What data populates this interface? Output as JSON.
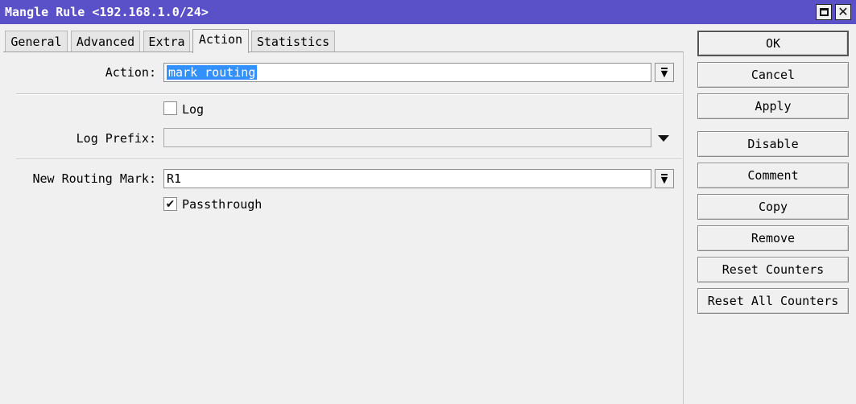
{
  "window": {
    "title": "Mangle Rule <192.168.1.0/24>"
  },
  "tabs": [
    {
      "label": "General"
    },
    {
      "label": "Advanced"
    },
    {
      "label": "Extra"
    },
    {
      "label": "Action"
    },
    {
      "label": "Statistics"
    }
  ],
  "active_tab": "Action",
  "form": {
    "action": {
      "label": "Action:",
      "value": "mark routing"
    },
    "log": {
      "label": "Log",
      "checked": false
    },
    "log_prefix": {
      "label": "Log Prefix:",
      "value": ""
    },
    "new_routing_mark": {
      "label": "New Routing Mark:",
      "value": "R1"
    },
    "passthrough": {
      "label": "Passthrough",
      "checked": true
    }
  },
  "buttons": {
    "ok": "OK",
    "cancel": "Cancel",
    "apply": "Apply",
    "disable": "Disable",
    "comment": "Comment",
    "copy": "Copy",
    "remove": "Remove",
    "reset_counters": "Reset Counters",
    "reset_all_counters": "Reset All Counters"
  },
  "icons": {
    "maximize": "maximize-icon",
    "close": "close-icon",
    "dropdown": "dropdown-arrow-icon",
    "checkmark": "checkmark-icon"
  },
  "colors": {
    "titlebar": "#5a50c8",
    "selection": "#3390ff",
    "background": "#f0f0f0"
  }
}
